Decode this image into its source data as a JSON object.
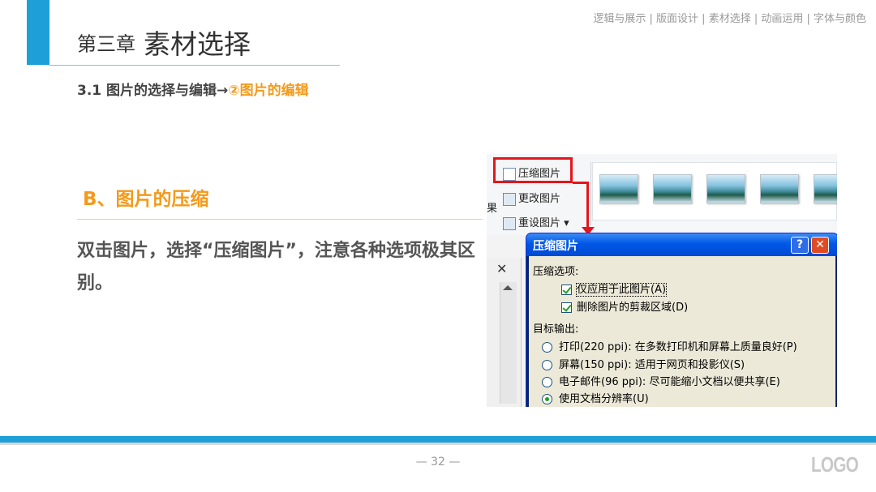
{
  "header": {
    "chapter_number": "第三章",
    "chapter_title": "素材选择",
    "nav": "逻辑与展示 | 版面设计 | 素材选择 | 动画运用 | 字体与颜色"
  },
  "section": {
    "prefix": "3.1 图片的选择与编辑→",
    "highlight": "②图片的编辑"
  },
  "content": {
    "subtitle": "B、图片的压缩",
    "body": "双击图片，选择“压缩图片”，注意各种选项极其区别。"
  },
  "screenshot": {
    "ribbon": {
      "compress_label": "压缩图片",
      "change_label": "更改图片",
      "reset_label": "重设图片 ▾",
      "fragment": "果"
    },
    "side_close": "✕",
    "dialog": {
      "title": "压缩图片",
      "help_label": "?",
      "close_label": "✕",
      "compress_options_label": "压缩选项:",
      "checkbox_apply": "仅应用于此图片(A)",
      "checkbox_delete": "删除图片的剪裁区域(D)",
      "target_label": "目标输出:",
      "radios": [
        {
          "label": "打印(220 ppi): 在多数打印机和屏幕上质量良好(P)",
          "selected": false
        },
        {
          "label": "屏幕(150 ppi): 适用于网页和投影仪(S)",
          "selected": false
        },
        {
          "label": "电子邮件(96 ppi): 尽可能缩小文档以便共享(E)",
          "selected": false
        },
        {
          "label": "使用文档分辨率(U)",
          "selected": true
        }
      ]
    }
  },
  "footer": {
    "page": "— 32 —",
    "logo": "LOGO"
  },
  "colors": {
    "accent_blue": "#1E9FD8",
    "accent_orange": "#F39A1B",
    "highlight_red": "#E4161C"
  }
}
